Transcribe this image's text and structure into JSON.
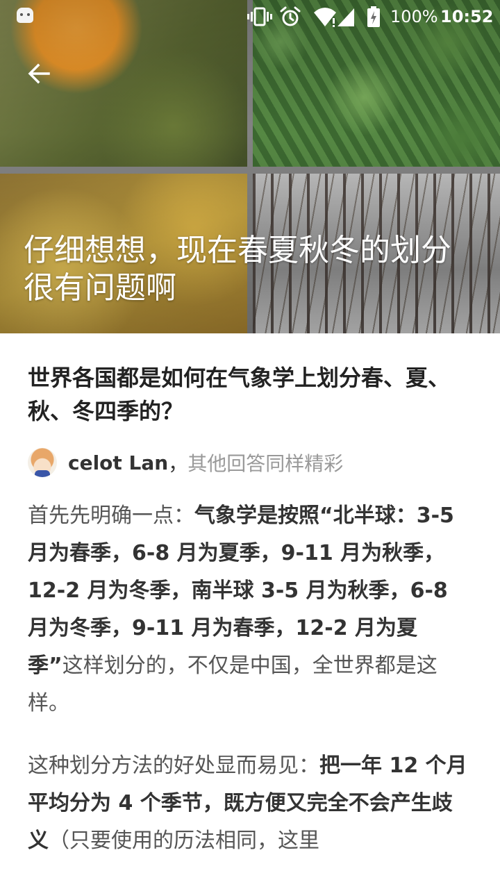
{
  "status_bar": {
    "battery": "100%",
    "time": "10:52",
    "icons": [
      "app-notification-icon",
      "vibrate-icon",
      "alarm-icon",
      "wifi-icon",
      "signal-icon",
      "battery-icon"
    ]
  },
  "header": {
    "back_icon": "back-arrow-icon",
    "title": "仔细想想，现在春夏秋冬的划分很有问题啊"
  },
  "question": {
    "title": "世界各国都是如何在气象学上划分春、夏、秋、冬四季的？"
  },
  "author": {
    "name": "celot Lan",
    "separator": "，",
    "note": "其他回答同样精彩"
  },
  "answer": {
    "p1": {
      "a": "首先先明确一点：",
      "b": "气象学是按照“北半球：3-5 月为春季，6-8 月为夏季，9-11 月为秋季，12-2 月为冬季，南半球 3-5 月为秋季，6-8 月为冬季，9-11 月为春季，12-2 月为夏季”",
      "c": "这样划分的，不仅是中国，全世界都是这样。"
    },
    "p2": {
      "a": "这种划分方法的好处显而易见：",
      "b": "把一年 12 个月平均分为 4 个季节，既方便又完全不会产生歧义",
      "c": "（只要使用的历法相同，这里"
    }
  }
}
